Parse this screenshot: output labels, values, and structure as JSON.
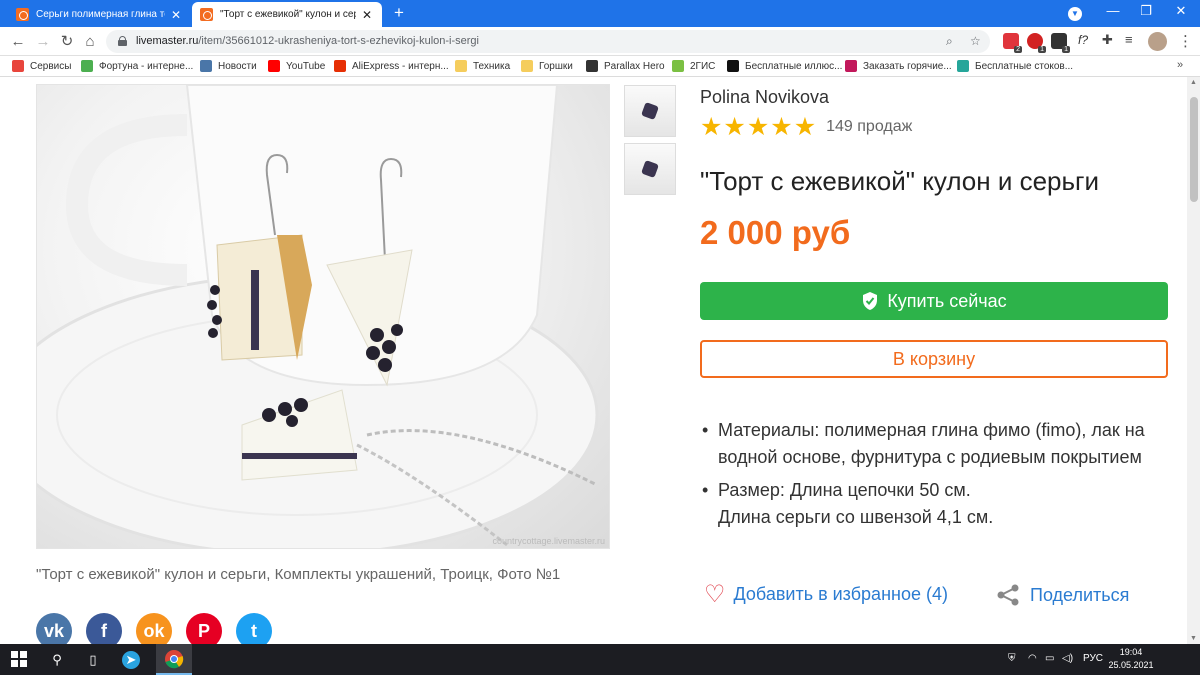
{
  "browser": {
    "tabs": [
      {
        "title": "Серьги полимерная глина торт",
        "active": false
      },
      {
        "title": "\"Торт с ежевикой\" кулон и серьг",
        "active": true
      }
    ],
    "new_tab": "+",
    "tab_close": "✕",
    "window_controls": {
      "minimize": "—",
      "restore": "❐",
      "close": "✕"
    },
    "url": {
      "domain": "livemaster.ru",
      "path": "/item/35661012-ukrasheniya-tort-s-ezhevikoj-kulon-i-sergi"
    },
    "nav": {
      "back": "←",
      "forward": "→",
      "reload": "↻",
      "home": "⌂"
    },
    "extensions": [
      {
        "name": "abp-icon",
        "badge": "2",
        "color": "#e0353c"
      },
      {
        "name": "adblock-icon",
        "badge": "1",
        "color": "#d22222"
      },
      {
        "name": "ext-dark-icon",
        "badge": "1",
        "color": "#333333"
      }
    ],
    "fx_label": "f?",
    "bookmarks": [
      {
        "label": "Сервисы",
        "icon": "apps-icon",
        "color": "#e8453c"
      },
      {
        "label": "Фортуна - интерне...",
        "icon": "clover-icon",
        "color": "#4caf50"
      },
      {
        "label": "Новости",
        "icon": "vk-icon",
        "color": "#4a76a8"
      },
      {
        "label": "YouTube",
        "icon": "youtube-icon",
        "color": "#ff0000"
      },
      {
        "label": "AliExpress - интерн...",
        "icon": "aliexpress-icon",
        "color": "#e62e04"
      },
      {
        "label": "Техника",
        "icon": "folder-icon",
        "color": "#f5cd5d"
      },
      {
        "label": "Горшки",
        "icon": "folder-icon",
        "color": "#f5cd5d"
      },
      {
        "label": "Parallax Hero",
        "icon": "parallax-icon",
        "color": "#333333"
      },
      {
        "label": "2ГИС",
        "icon": "2gis-icon",
        "color": "#7bc043"
      },
      {
        "label": "Бесплатные иллюс...",
        "icon": "plus-circle-icon",
        "color": "#111111"
      },
      {
        "label": "Заказать горячие...",
        "icon": "food-icon",
        "color": "#c2185b"
      },
      {
        "label": "Бесплатные стоков...",
        "icon": "stock-icon",
        "color": "#26a69a"
      }
    ],
    "bookmarks_more": "»"
  },
  "product": {
    "seller": "Polina Novikova",
    "rating_stars": 5,
    "sales": "149 продаж",
    "title": "\"Торт с ежевикой\" кулон и серьги",
    "price": "2 000 руб",
    "buy_label": "Купить сейчас",
    "cart_label": "В корзину",
    "details": [
      {
        "line1": "Материалы:  полимерная глина фимо (fimo), лак на водной основе, фурнитура с родиевым покрытием",
        "line2": ""
      },
      {
        "line1": "Размер:  Длина цепочки 50 см.",
        "line2": "Длина серьги со швензой 4,1 см."
      }
    ],
    "favorite_label": "Добавить в избранное (4)",
    "share_label": "Поделиться",
    "photo_caption": "\"Торт с ежевикой\" кулон и серьги, Комплекты украшений, Троицк, Фото №1",
    "watermark": "countrycottage.livemaster.ru",
    "social": [
      {
        "name": "vk-share-button",
        "glyph": "vk",
        "color": "#4a76a8"
      },
      {
        "name": "facebook-share-button",
        "glyph": "f",
        "color": "#3b5998"
      },
      {
        "name": "odnoklassniki-share-button",
        "glyph": "ok",
        "color": "#f7931e"
      },
      {
        "name": "pinterest-share-button",
        "glyph": "P",
        "color": "#e60023"
      },
      {
        "name": "twitter-share-button",
        "glyph": "t",
        "color": "#1da1f2"
      }
    ],
    "accent_color": "#f26b1d",
    "buy_color": "#2db34a"
  },
  "taskbar": {
    "language": "РУС",
    "time": "19:04",
    "date": "25.05.2021"
  }
}
